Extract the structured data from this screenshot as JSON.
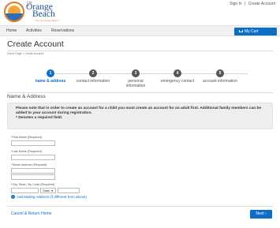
{
  "header": {
    "brand": {
      "prefix": "City of",
      "line1": "Orange",
      "line2": "Beach",
      "tagline": "City of Orange Beach"
    },
    "sign_in": "Sign In",
    "separator": "|",
    "create_account": "Create Account"
  },
  "nav": {
    "items": [
      "Home",
      "Activities",
      "Reservations"
    ],
    "cart": "My Cart"
  },
  "page": {
    "title": "Create Account",
    "breadcrumb": "Home Page > Create Account"
  },
  "steps": [
    {
      "number": "1",
      "label": "name & address",
      "active": true
    },
    {
      "number": "2",
      "label": "contact information",
      "active": false
    },
    {
      "number": "3",
      "label": "personal information",
      "active": false
    },
    {
      "number": "4",
      "label": "emergency contact",
      "active": false
    },
    {
      "number": "5",
      "label": "account information",
      "active": false
    }
  ],
  "section": {
    "title": "Name & Address",
    "notice_1": "Please note that in order to create an account for a child you must create an account for an adult first. Additional family members can be added to your account during registration.",
    "notice_2": "* Denotes a required field."
  },
  "form": {
    "first_name_label": "*First Name (Required)",
    "last_name_label": "*Last Name (Required)",
    "street_label": "*Street Address (Required)",
    "city_state_zip_label": "*City, State, Zip Code (Required)",
    "state_value": "State",
    "add_mailing": "Add Mailing Address (if different from above)",
    "add_mailing_icon": "+"
  },
  "footer": {
    "cancel": "Cancel & Return Home",
    "next": "Next"
  },
  "colors": {
    "accent": "#0d6ec8",
    "brand_orange": "#e87722",
    "step_inactive": "#555555"
  }
}
